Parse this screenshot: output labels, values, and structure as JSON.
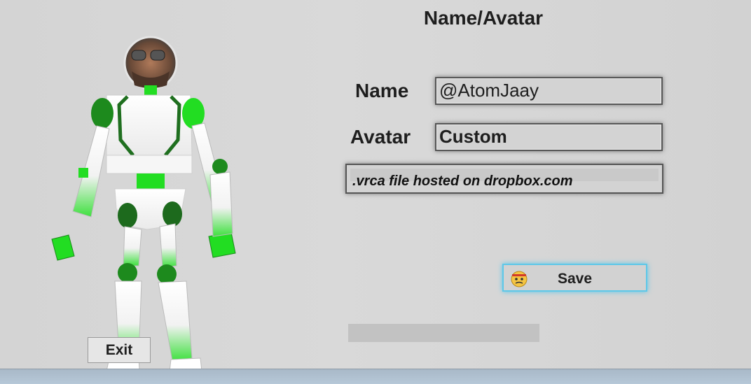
{
  "header": {
    "title": "Name/Avatar"
  },
  "form": {
    "name_label": "Name",
    "name_value": "@AtomJaay",
    "avatar_label": "Avatar",
    "avatar_value": "Custom",
    "url_value": ".vrca file hosted on dropbox.com"
  },
  "save_button": {
    "label": "Save",
    "icon": "angry-face-icon"
  },
  "exit_button": {
    "label": "Exit"
  },
  "colors": {
    "accent_glow": "#5ec8e8",
    "robot_green": "#22dd22",
    "background": "#d6d6d6"
  }
}
